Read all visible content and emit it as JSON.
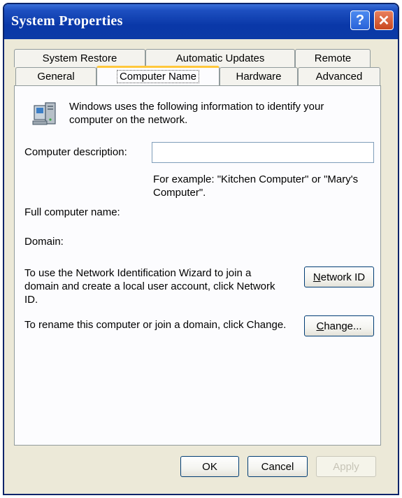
{
  "window": {
    "title": "System Properties",
    "help_glyph": "?",
    "close_glyph": "✕"
  },
  "tabs": {
    "row_top": [
      "System Restore",
      "Automatic Updates",
      "Remote"
    ],
    "row_bottom": [
      "General",
      "Computer Name",
      "Hardware",
      "Advanced"
    ],
    "active": "Computer Name"
  },
  "computer_name_tab": {
    "intro": "Windows uses the following information to identify your computer on the network.",
    "description_label": "Computer description:",
    "description_value": "",
    "example": "For example: \"Kitchen Computer\" or \"Mary's Computer\".",
    "full_name_label": "Full computer name:",
    "full_name_value": "",
    "domain_label": "Domain:",
    "domain_value": "",
    "network_id_text": "To use the Network Identification Wizard to join a domain and create a local user account, click Network ID.",
    "network_id_button": "Network ID",
    "rename_text": "To rename this computer or join a domain, click Change.",
    "change_button": "Change..."
  },
  "footer": {
    "ok": "OK",
    "cancel": "Cancel",
    "apply": "Apply"
  },
  "colors": {
    "titlebar": "#0a38a8",
    "dialog_bg": "#ece9d8",
    "panel_bg": "#fcfcfe",
    "active_tab_accent": "#ffc83c"
  }
}
